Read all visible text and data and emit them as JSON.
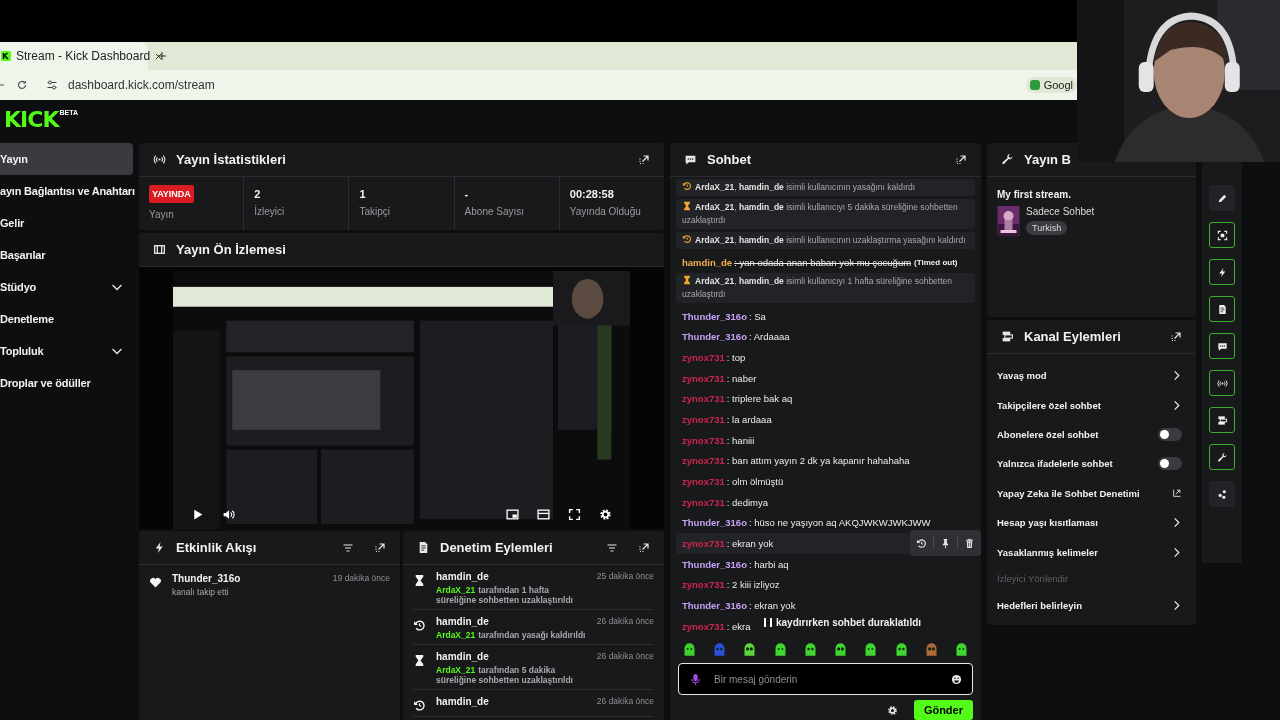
{
  "browser": {
    "tab_title": "Stream - Kick Dashboard",
    "url": "dashboard.kick.com/stream",
    "profile_button": "Googl"
  },
  "logo": {
    "text": "KICK",
    "badge": "BETA"
  },
  "sidebar": {
    "items": [
      {
        "label": "Yayın",
        "kind": "link",
        "selected": true
      },
      {
        "label": "ayın Bağlantısı ve Anahtarı",
        "kind": "link",
        "selected": false
      },
      {
        "label": "Gelir",
        "kind": "link",
        "selected": false
      },
      {
        "label": "Başarılar",
        "kind": "link",
        "selected": false
      },
      {
        "label": "Stüdyo",
        "kind": "group",
        "selected": false
      },
      {
        "label": "Denetleme",
        "kind": "link",
        "selected": false
      },
      {
        "label": "Topluluk",
        "kind": "group",
        "selected": false
      },
      {
        "label": "Droplar ve ödüller",
        "kind": "link",
        "selected": false
      }
    ]
  },
  "stats": {
    "title": "Yayın İstatistikleri",
    "cells": [
      {
        "kind": "badge",
        "value": "YAYINDA",
        "label": "Yayın"
      },
      {
        "kind": "number",
        "value": "2",
        "label": "İzleyici"
      },
      {
        "kind": "number",
        "value": "1",
        "label": "Takipçi"
      },
      {
        "kind": "number",
        "value": "-",
        "label": "Abone Sayısı"
      },
      {
        "kind": "number",
        "value": "00:28:58",
        "label": "Yayında Olduğu"
      }
    ]
  },
  "preview": {
    "title": "Yayın Ön İzlemesi"
  },
  "activity": {
    "title": "Etkinlik Akışı",
    "items": [
      {
        "kind": "follow",
        "user": "Thunder_316o",
        "text": "kanalı takip etti",
        "time": "19 dakika önce"
      }
    ]
  },
  "moderation": {
    "title": "Denetim Eylemleri",
    "items": [
      {
        "kind": "timeout",
        "user": "hamdin_de",
        "time": "25 dakika önce",
        "actor": "ArdaX_21",
        "text": "tarafından 1 hafta süreliğine sohbetten uzaklaştırıldı"
      },
      {
        "kind": "unban",
        "user": "hamdin_de",
        "time": "26 dakika önce",
        "actor": "ArdaX_21",
        "text": "tarafından yasağı kaldırıldı"
      },
      {
        "kind": "timeout",
        "user": "hamdin_de",
        "time": "26 dakika önce",
        "actor": "ArdaX_21",
        "text": "tarafından 5 dakika süreliğine sohbetten uzaklaştırıldı"
      },
      {
        "kind": "unban",
        "user": "hamdin_de",
        "time": "26 dakika önce"
      }
    ]
  },
  "chat": {
    "title": "Sohbet",
    "messages": [
      {
        "kind": "unban",
        "text": "**ArdaX_21**, **hamdin_de** isimli kullanıcının yasağını kaldırdı",
        "hovered": false
      },
      {
        "kind": "timeout",
        "text": "**ArdaX_21**, **hamdin_de** isimli kullanıcıyı 5 dakika süreliğine sohbetten uzaklaştırdı",
        "hovered": false
      },
      {
        "kind": "unban",
        "text": "**ArdaX_21**, **hamdin_de** isimli kullanıcının uzaklaştırma yasağını kaldırdı",
        "hovered": false
      },
      {
        "kind": "deleted",
        "user": "hamdin_de",
        "color": "#f0b04f",
        "text": ": yan odada anan baban yok mu çocuğum",
        "note": "(Timed out)",
        "hovered": false
      },
      {
        "kind": "timeout",
        "text": "**ArdaX_21**, **hamdin_de** isimli kullanıcıyı 1 hafta süreliğine sohbetten uzaklaştırdı",
        "hovered": false
      },
      {
        "kind": "message",
        "user": "Thunder_316o",
        "color": "#c6a0f5",
        "text": ": Sa",
        "hovered": false
      },
      {
        "kind": "message",
        "user": "Thunder_316o",
        "color": "#c6a0f5",
        "text": ": Ardaaaa",
        "hovered": false
      },
      {
        "kind": "message",
        "user": "zynox731",
        "color": "#cf2350",
        "text": ": top",
        "hovered": false
      },
      {
        "kind": "message",
        "user": "zynox731",
        "color": "#cf2350",
        "text": ": naber",
        "hovered": false
      },
      {
        "kind": "message",
        "user": "zynox731",
        "color": "#cf2350",
        "text": ": triplere bak aq",
        "hovered": false
      },
      {
        "kind": "message",
        "user": "zynox731",
        "color": "#cf2350",
        "text": ": la ardaaa",
        "hovered": false
      },
      {
        "kind": "message",
        "user": "zynox731",
        "color": "#cf2350",
        "text": ": haniii",
        "hovered": false
      },
      {
        "kind": "message",
        "user": "zynox731",
        "color": "#cf2350",
        "text": ": ban attım yayın 2 dk ya kapanır hahahaha",
        "hovered": false
      },
      {
        "kind": "message",
        "user": "zynox731",
        "color": "#cf2350",
        "text": ": olm ölmüştü",
        "hovered": false
      },
      {
        "kind": "message",
        "user": "zynox731",
        "color": "#cf2350",
        "text": ": dedimya",
        "hovered": false
      },
      {
        "kind": "message",
        "user": "Thunder_316o",
        "color": "#c6a0f5",
        "text": ": hüso ne yaşıyon aq AKQJWKWJWKJWW",
        "hovered": false
      },
      {
        "kind": "message",
        "user": "zynox731",
        "color": "#cf2350",
        "text": ": ekran yok",
        "hovered": true
      },
      {
        "kind": "message",
        "user": "Thunder_316o",
        "color": "#c6a0f5",
        "text": ": harbi aq",
        "hovered": false
      },
      {
        "kind": "message",
        "user": "zynox731",
        "color": "#cf2350",
        "text": ": 2 kiii izliyoz",
        "hovered": false
      },
      {
        "kind": "message",
        "user": "Thunder_316o",
        "color": "#c6a0f5",
        "text": ": ekran yok",
        "hovered": false
      },
      {
        "kind": "message",
        "user": "zynox731",
        "color": "#cf2350",
        "text": ": ekra",
        "hovered": false
      }
    ],
    "paused_notice": "kaydırırken sohbet duraklatıldı",
    "input": {
      "placeholder": "Bir mesaj gönderin"
    },
    "send_button": "Gönder"
  },
  "stream_info": {
    "title": "Yayın B",
    "stream_title": "My first stream.",
    "category": "Sadece Sohbet",
    "tag": "Turkish"
  },
  "channel_actions": {
    "title": "Kanal Eylemleri",
    "items": [
      {
        "kind": "submenu",
        "label": "Yavaş mod"
      },
      {
        "kind": "submenu",
        "label": "Takipçilere özel sohbet"
      },
      {
        "kind": "toggle",
        "label": "Abonelere özel sohbet",
        "on": false
      },
      {
        "kind": "toggle",
        "label": "Yalnızca ifadelerle sohbet",
        "on": false
      },
      {
        "kind": "external",
        "label": "Yapay Zeka ile Sohbet Denetimi"
      },
      {
        "kind": "submenu",
        "label": "Hesap yaşı kısıtlaması"
      },
      {
        "kind": "submenu",
        "label": "Yasaklanmış kelimeler"
      },
      {
        "kind": "heading",
        "label": "İzleyici Yönlendir"
      },
      {
        "kind": "submenu",
        "label": "Hedefleri belirleyin"
      }
    ]
  },
  "rail": {
    "items": [
      {
        "kind": "pencil",
        "active": false
      },
      {
        "kind": "scan",
        "active": true
      },
      {
        "kind": "bolt",
        "active": true
      },
      {
        "kind": "doc",
        "active": true
      },
      {
        "kind": "chat",
        "active": true
      },
      {
        "kind": "broadcast",
        "active": true
      },
      {
        "kind": "actions",
        "active": true
      },
      {
        "kind": "wrench",
        "active": true
      },
      {
        "kind": "dots",
        "active": false
      }
    ]
  }
}
